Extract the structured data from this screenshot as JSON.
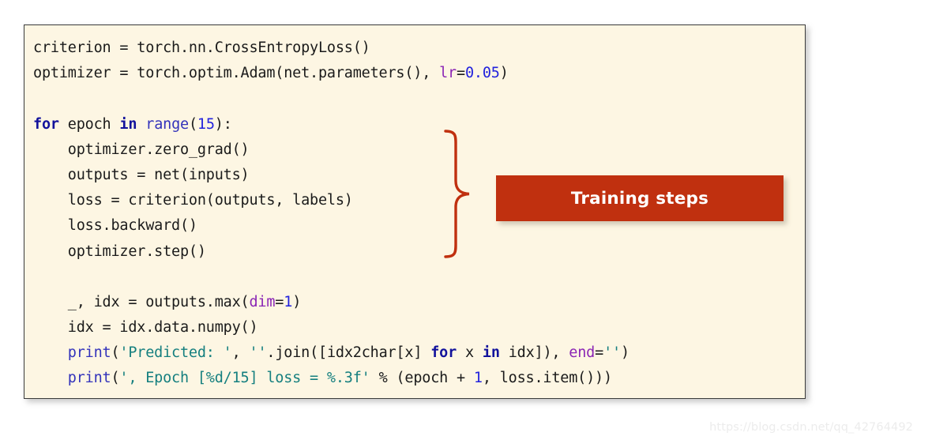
{
  "panel": {
    "background_color": "#fdf6e3",
    "border_color": "#3a3a3a"
  },
  "code": {
    "language": "python",
    "lines": [
      [
        {
          "t": "criterion = torch.nn.CrossEntropyLoss()",
          "c": "plain"
        }
      ],
      [
        {
          "t": "optimizer = torch.optim.Adam(net.parameters(), ",
          "c": "plain"
        },
        {
          "t": "lr",
          "c": "kwarg"
        },
        {
          "t": "=",
          "c": "op"
        },
        {
          "t": "0.05",
          "c": "num"
        },
        {
          "t": ")",
          "c": "plain"
        }
      ],
      [
        {
          "t": "",
          "c": "plain"
        }
      ],
      [
        {
          "t": "for",
          "c": "kw"
        },
        {
          "t": " epoch ",
          "c": "plain"
        },
        {
          "t": "in",
          "c": "kw"
        },
        {
          "t": " ",
          "c": "plain"
        },
        {
          "t": "range",
          "c": "builtin"
        },
        {
          "t": "(",
          "c": "plain"
        },
        {
          "t": "15",
          "c": "num"
        },
        {
          "t": "):",
          "c": "plain"
        }
      ],
      [
        {
          "t": "    optimizer.zero_grad()",
          "c": "plain"
        }
      ],
      [
        {
          "t": "    outputs = net(inputs)",
          "c": "plain"
        }
      ],
      [
        {
          "t": "    loss = criterion(outputs, labels)",
          "c": "plain"
        }
      ],
      [
        {
          "t": "    loss.backward()",
          "c": "plain"
        }
      ],
      [
        {
          "t": "    optimizer.step()",
          "c": "plain"
        }
      ],
      [
        {
          "t": "",
          "c": "plain"
        }
      ],
      [
        {
          "t": "    _, idx = outputs.max(",
          "c": "plain"
        },
        {
          "t": "dim",
          "c": "kwarg"
        },
        {
          "t": "=",
          "c": "op"
        },
        {
          "t": "1",
          "c": "num"
        },
        {
          "t": ")",
          "c": "plain"
        }
      ],
      [
        {
          "t": "    idx = idx.data.numpy()",
          "c": "plain"
        }
      ],
      [
        {
          "t": "    ",
          "c": "plain"
        },
        {
          "t": "print",
          "c": "builtin"
        },
        {
          "t": "(",
          "c": "plain"
        },
        {
          "t": "'Predicted: '",
          "c": "str"
        },
        {
          "t": ", ",
          "c": "plain"
        },
        {
          "t": "''",
          "c": "str"
        },
        {
          "t": ".join([idx2char[x] ",
          "c": "plain"
        },
        {
          "t": "for",
          "c": "kw"
        },
        {
          "t": " x ",
          "c": "plain"
        },
        {
          "t": "in",
          "c": "kw"
        },
        {
          "t": " idx]), ",
          "c": "plain"
        },
        {
          "t": "end",
          "c": "kwarg"
        },
        {
          "t": "=",
          "c": "op"
        },
        {
          "t": "''",
          "c": "str"
        },
        {
          "t": ")",
          "c": "plain"
        }
      ],
      [
        {
          "t": "    ",
          "c": "plain"
        },
        {
          "t": "print",
          "c": "builtin"
        },
        {
          "t": "(",
          "c": "plain"
        },
        {
          "t": "', Epoch [%d/15] loss = %.3f'",
          "c": "str"
        },
        {
          "t": " % (epoch + ",
          "c": "plain"
        },
        {
          "t": "1",
          "c": "num"
        },
        {
          "t": ", loss.item()))",
          "c": "plain"
        }
      ]
    ]
  },
  "annotation": {
    "banner_label": "Training steps",
    "banner_color": "#c0300f",
    "brace_color": "#c0300f",
    "brace_shape": "right-curly-brace"
  },
  "watermark": {
    "text": "https://blog.csdn.net/qq_42764492",
    "color": "#ececec"
  }
}
